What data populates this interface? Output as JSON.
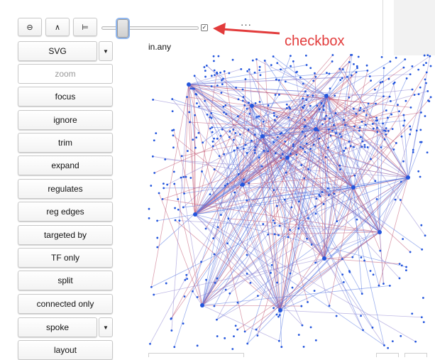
{
  "toolbar": {
    "zoom_out_icon": "⊖",
    "up_icon": "∧",
    "tree_icon": "⊨",
    "checkbox_mark": "✓",
    "more_label": "···"
  },
  "annotation": {
    "text": "checkbox",
    "color": "#e23b3b"
  },
  "graph": {
    "title": "in.any",
    "node_color": "#2255dd",
    "edge_colors": [
      "#4a6fe0",
      "#c0506e",
      "#8a7fd0"
    ]
  },
  "sidebar": {
    "format_select": "SVG",
    "buttons": [
      "zoom",
      "focus",
      "ignore",
      "trim",
      "expand",
      "regulates",
      "reg edges",
      "targeted by",
      "TF only",
      "split",
      "connected only"
    ],
    "layout_select": "spoke",
    "layout_button": "layout"
  },
  "caret": "▼"
}
